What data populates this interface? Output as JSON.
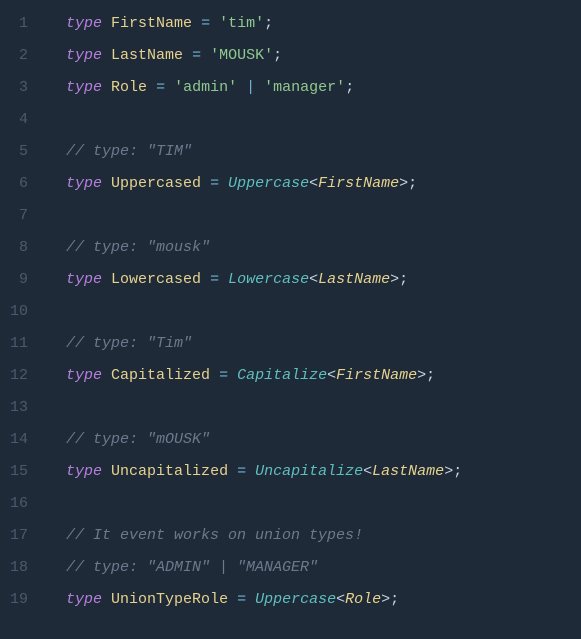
{
  "lines": [
    {
      "n": "1",
      "tokens": [
        {
          "t": "kw",
          "v": "type"
        },
        {
          "t": "punct",
          "v": " "
        },
        {
          "t": "typename",
          "v": "FirstName"
        },
        {
          "t": "punct",
          "v": " "
        },
        {
          "t": "op",
          "v": "="
        },
        {
          "t": "punct",
          "v": " "
        },
        {
          "t": "str",
          "v": "'tim'"
        },
        {
          "t": "punct",
          "v": ";"
        }
      ]
    },
    {
      "n": "2",
      "tokens": [
        {
          "t": "kw",
          "v": "type"
        },
        {
          "t": "punct",
          "v": " "
        },
        {
          "t": "typename",
          "v": "LastName"
        },
        {
          "t": "punct",
          "v": " "
        },
        {
          "t": "op",
          "v": "="
        },
        {
          "t": "punct",
          "v": " "
        },
        {
          "t": "str",
          "v": "'MOUSK'"
        },
        {
          "t": "punct",
          "v": ";"
        }
      ]
    },
    {
      "n": "3",
      "tokens": [
        {
          "t": "kw",
          "v": "type"
        },
        {
          "t": "punct",
          "v": " "
        },
        {
          "t": "typename",
          "v": "Role"
        },
        {
          "t": "punct",
          "v": " "
        },
        {
          "t": "op",
          "v": "="
        },
        {
          "t": "punct",
          "v": " "
        },
        {
          "t": "str",
          "v": "'admin'"
        },
        {
          "t": "punct",
          "v": " "
        },
        {
          "t": "op",
          "v": "|"
        },
        {
          "t": "punct",
          "v": " "
        },
        {
          "t": "str",
          "v": "'manager'"
        },
        {
          "t": "punct",
          "v": ";"
        }
      ]
    },
    {
      "n": "4",
      "tokens": []
    },
    {
      "n": "5",
      "tokens": [
        {
          "t": "comment",
          "v": "// type: \"TIM\""
        }
      ]
    },
    {
      "n": "6",
      "tokens": [
        {
          "t": "kw",
          "v": "type"
        },
        {
          "t": "punct",
          "v": " "
        },
        {
          "t": "typename",
          "v": "Uppercased"
        },
        {
          "t": "punct",
          "v": " "
        },
        {
          "t": "op",
          "v": "="
        },
        {
          "t": "punct",
          "v": " "
        },
        {
          "t": "generic",
          "v": "Uppercase"
        },
        {
          "t": "punct",
          "v": "<"
        },
        {
          "t": "gentype",
          "v": "FirstName"
        },
        {
          "t": "punct",
          "v": ">;"
        }
      ]
    },
    {
      "n": "7",
      "tokens": []
    },
    {
      "n": "8",
      "tokens": [
        {
          "t": "comment",
          "v": "// type: \"mousk\""
        }
      ]
    },
    {
      "n": "9",
      "tokens": [
        {
          "t": "kw",
          "v": "type"
        },
        {
          "t": "punct",
          "v": " "
        },
        {
          "t": "typename",
          "v": "Lowercased"
        },
        {
          "t": "punct",
          "v": " "
        },
        {
          "t": "op",
          "v": "="
        },
        {
          "t": "punct",
          "v": " "
        },
        {
          "t": "generic",
          "v": "Lowercase"
        },
        {
          "t": "punct",
          "v": "<"
        },
        {
          "t": "gentype",
          "v": "LastName"
        },
        {
          "t": "punct",
          "v": ">;"
        }
      ]
    },
    {
      "n": "10",
      "tokens": []
    },
    {
      "n": "11",
      "tokens": [
        {
          "t": "comment",
          "v": "// type: \"Tim\""
        }
      ]
    },
    {
      "n": "12",
      "tokens": [
        {
          "t": "kw",
          "v": "type"
        },
        {
          "t": "punct",
          "v": " "
        },
        {
          "t": "typename",
          "v": "Capitalized"
        },
        {
          "t": "punct",
          "v": " "
        },
        {
          "t": "op",
          "v": "="
        },
        {
          "t": "punct",
          "v": " "
        },
        {
          "t": "generic",
          "v": "Capitalize"
        },
        {
          "t": "punct",
          "v": "<"
        },
        {
          "t": "gentype",
          "v": "FirstName"
        },
        {
          "t": "punct",
          "v": ">;"
        }
      ]
    },
    {
      "n": "13",
      "tokens": []
    },
    {
      "n": "14",
      "tokens": [
        {
          "t": "comment",
          "v": "// type: \"mOUSK\""
        }
      ]
    },
    {
      "n": "15",
      "tokens": [
        {
          "t": "kw",
          "v": "type"
        },
        {
          "t": "punct",
          "v": " "
        },
        {
          "t": "typename",
          "v": "Uncapitalized"
        },
        {
          "t": "punct",
          "v": " "
        },
        {
          "t": "op",
          "v": "="
        },
        {
          "t": "punct",
          "v": " "
        },
        {
          "t": "generic",
          "v": "Uncapitalize"
        },
        {
          "t": "punct",
          "v": "<"
        },
        {
          "t": "gentype",
          "v": "LastName"
        },
        {
          "t": "punct",
          "v": ">;"
        }
      ]
    },
    {
      "n": "16",
      "tokens": []
    },
    {
      "n": "17",
      "tokens": [
        {
          "t": "comment",
          "v": "// It event works on union types!"
        }
      ]
    },
    {
      "n": "18",
      "tokens": [
        {
          "t": "comment",
          "v": "// type: \"ADMIN\" | \"MANAGER\""
        }
      ]
    },
    {
      "n": "19",
      "tokens": [
        {
          "t": "kw",
          "v": "type"
        },
        {
          "t": "punct",
          "v": " "
        },
        {
          "t": "typename",
          "v": "UnionTypeRole"
        },
        {
          "t": "punct",
          "v": " "
        },
        {
          "t": "op",
          "v": "="
        },
        {
          "t": "punct",
          "v": " "
        },
        {
          "t": "generic",
          "v": "Uppercase"
        },
        {
          "t": "punct",
          "v": "<"
        },
        {
          "t": "gentype",
          "v": "Role"
        },
        {
          "t": "punct",
          "v": ">;"
        }
      ]
    }
  ]
}
